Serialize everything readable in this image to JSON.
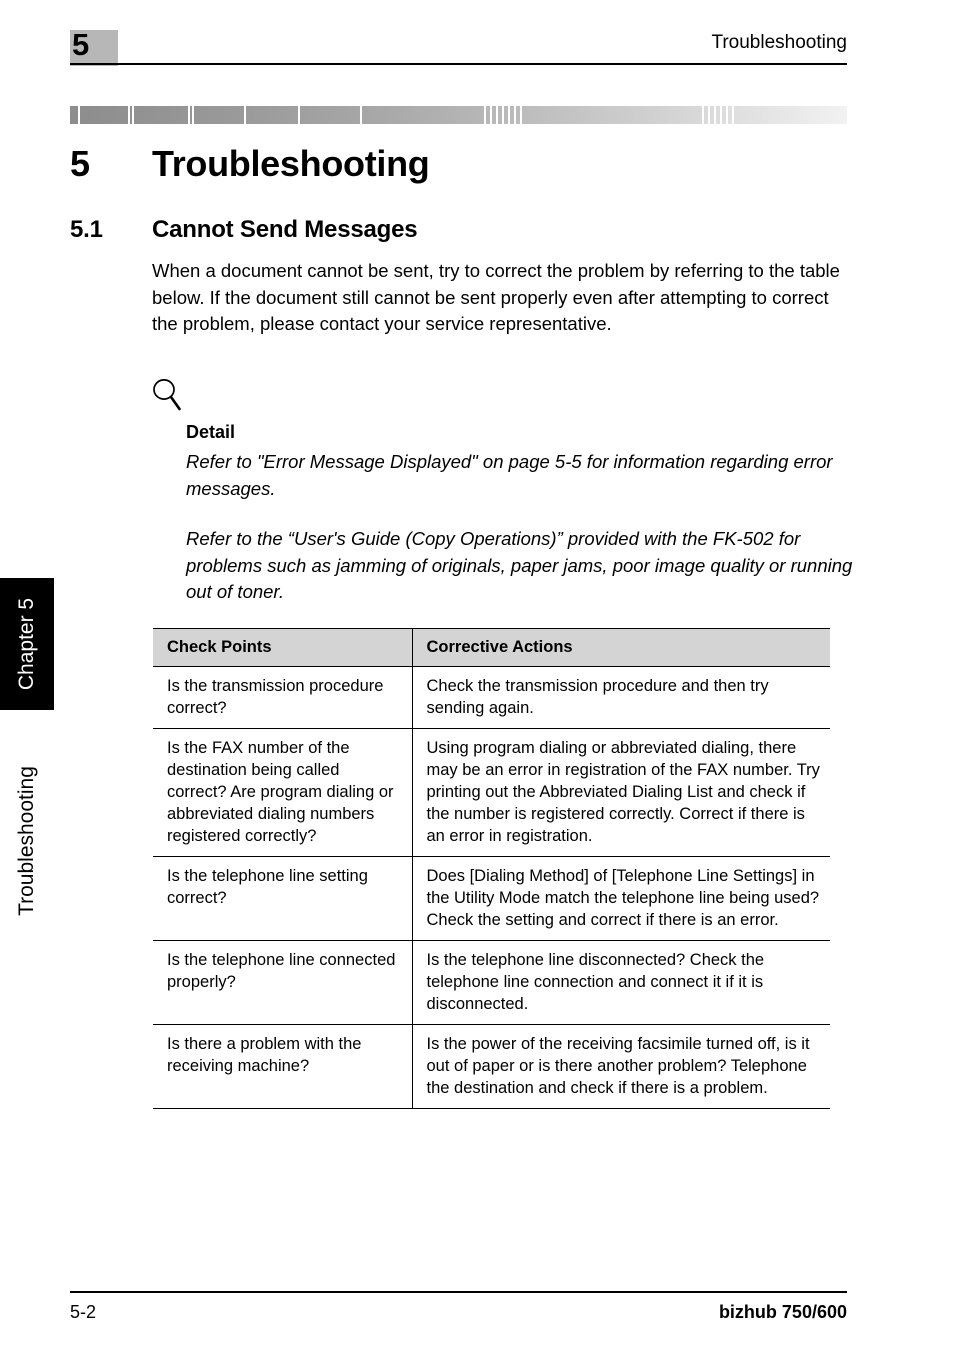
{
  "header": {
    "chapter_number": "5",
    "running_title": "Troubleshooting"
  },
  "side_tab": {
    "chapter_label": "Chapter 5",
    "section_label": "Troubleshooting"
  },
  "headings": {
    "chapter_num": "5",
    "chapter_title": "Troubleshooting",
    "section_num": "5.1",
    "section_title": "Cannot Send Messages"
  },
  "intro": "When a document cannot be sent, try to correct the problem by referring to the table below. If the document still cannot be sent properly even after attempting to correct the problem, please contact your service representative.",
  "note": {
    "icon": "magnifier-icon",
    "title": "Detail",
    "paragraph_1": "Refer to \"Error Message Displayed\" on page 5-5 for information regarding error messages.",
    "paragraph_2": "Refer to the “User's Guide (Copy Operations)” provided with the FK-502 for problems such as jamming of originals, paper jams, poor image quality or running out of toner."
  },
  "table": {
    "headers": [
      "Check Points",
      "Corrective Actions"
    ],
    "rows": [
      {
        "check": "Is the transmission procedure correct?",
        "action": "Check the transmission procedure and then try sending again."
      },
      {
        "check": "Is the FAX number of the destination being called correct? Are program dialing or abbreviated dialing numbers registered correctly?",
        "action": "Using program dialing or abbreviated dialing, there may be an error in registration of the FAX number. Try printing out the Abbreviated Dialing List and check if the number is registered correctly. Correct if there is an error in registration."
      },
      {
        "check": "Is the telephone line setting correct?",
        "action": "Does [Dialing Method] of [Telephone Line Settings] in the Utility Mode match the telephone line being used? Check the setting and correct if there is an error."
      },
      {
        "check": "Is the telephone line connected properly?",
        "action": "Is the telephone line disconnected? Check the telephone line connection and connect it if it is disconnected."
      },
      {
        "check": "Is there a problem with the receiving machine?",
        "action": "Is the power of the receiving facsimile turned off, is it out of paper or is there another problem? Telephone the destination and check if there is a problem."
      }
    ]
  },
  "footer": {
    "page_number": "5-2",
    "model": "bizhub 750/600"
  },
  "colors": {
    "chip_gray": "#b7b7b7",
    "table_header_gray": "#d4d4d4",
    "tab_black": "#000000",
    "rule_black": "#000000"
  }
}
